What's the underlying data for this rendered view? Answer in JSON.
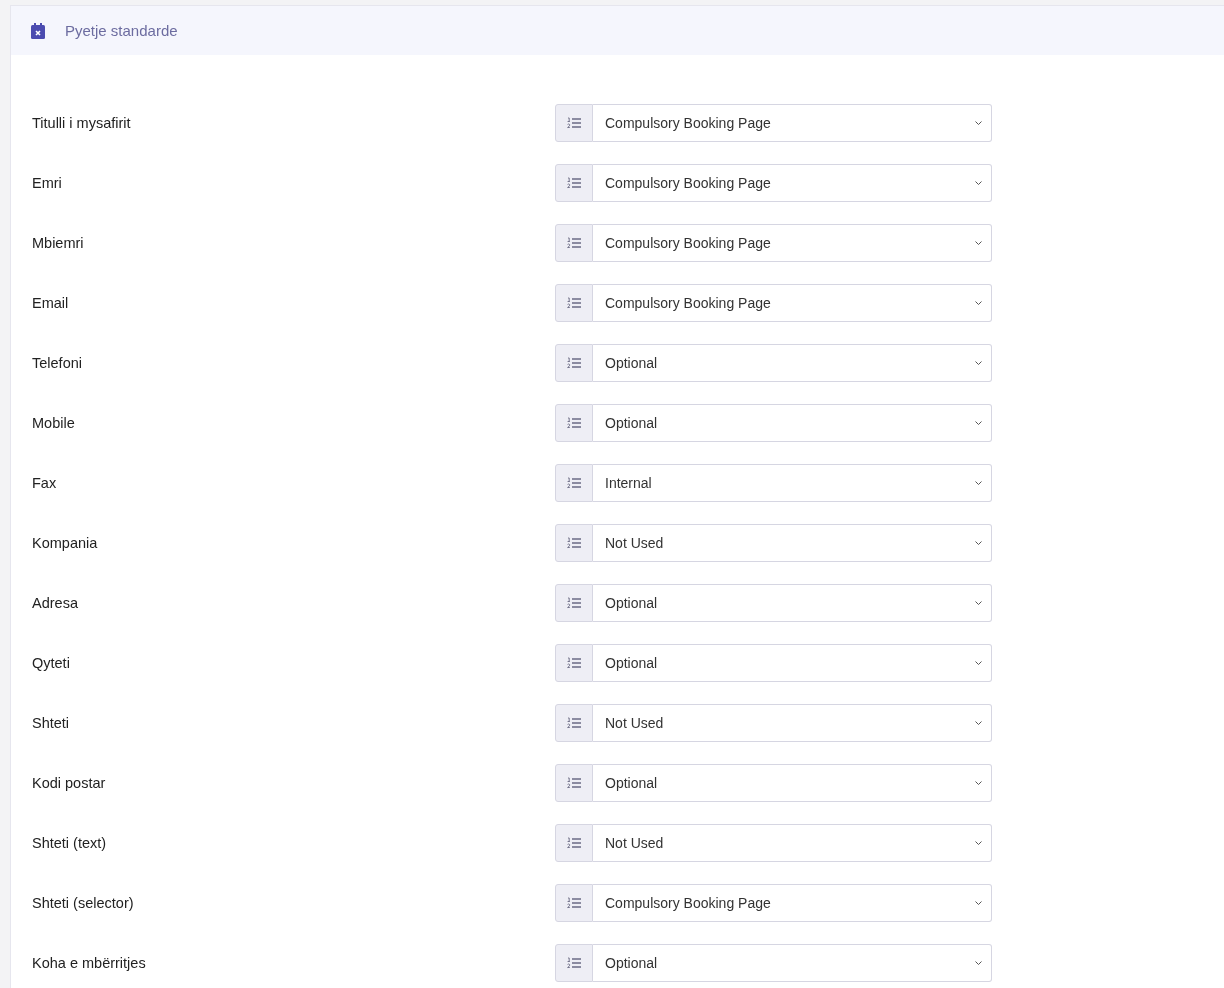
{
  "panel": {
    "title": "Pyetje standarde"
  },
  "fields": [
    {
      "label": "Titulli i mysafirit",
      "value": "Compulsory Booking Page"
    },
    {
      "label": "Emri",
      "value": "Compulsory Booking Page"
    },
    {
      "label": "Mbiemri",
      "value": "Compulsory Booking Page"
    },
    {
      "label": "Email",
      "value": "Compulsory Booking Page"
    },
    {
      "label": "Telefoni",
      "value": "Optional"
    },
    {
      "label": "Mobile",
      "value": "Optional"
    },
    {
      "label": "Fax",
      "value": "Internal"
    },
    {
      "label": "Kompania",
      "value": "Not Used"
    },
    {
      "label": "Adresa",
      "value": "Optional"
    },
    {
      "label": "Qyteti",
      "value": "Optional"
    },
    {
      "label": "Shteti",
      "value": "Not Used"
    },
    {
      "label": "Kodi postar",
      "value": "Optional"
    },
    {
      "label": "Shteti (text)",
      "value": "Not Used"
    },
    {
      "label": "Shteti (selector)",
      "value": "Compulsory Booking Page"
    },
    {
      "label": "Koha e mbërritjes",
      "value": "Optional"
    }
  ]
}
